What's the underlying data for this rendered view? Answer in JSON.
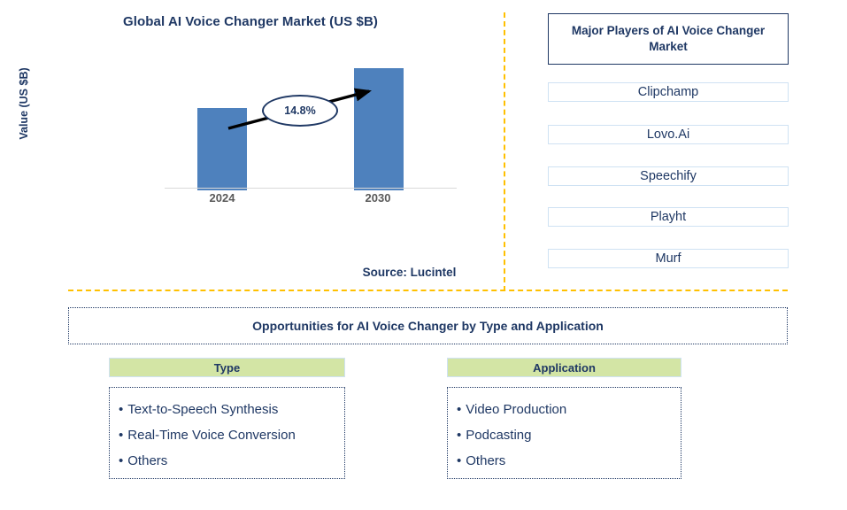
{
  "chart_panel": {
    "title": "Global AI Voice Changer Market (US $B)",
    "y_axis_label": "Value (US $B)",
    "source": "Source: Lucintel",
    "cagr_label": "14.8%"
  },
  "chart_data": {
    "type": "bar",
    "title": "Global AI Voice Changer Market (US $B)",
    "categories": [
      "2024",
      "2030"
    ],
    "values": [
      60,
      89
    ],
    "value_unit": "US $B",
    "xlabel": "",
    "ylabel": "Value (US $B)",
    "ylim": [
      0,
      100
    ],
    "grid": false,
    "legend": "none",
    "bar_color": "#4e81bd",
    "annotations": [
      {
        "text": "14.8%",
        "kind": "cagr-callout",
        "from_category": "2024",
        "to_category": "2030"
      }
    ],
    "axis_line_color": "#d9d9d9",
    "tick_label_color": "#595959"
  },
  "players_panel": {
    "header": "Major Players of AI Voice Changer Market",
    "items": [
      {
        "label": "Clipchamp"
      },
      {
        "label": "Lovo.Ai"
      },
      {
        "label": "Speechify"
      },
      {
        "label": "Playht"
      },
      {
        "label": "Murf"
      }
    ]
  },
  "opportunities": {
    "banner": "Opportunities for AI Voice Changer by Type and Application",
    "columns": [
      {
        "header": "Type",
        "bullet": "•",
        "items": [
          {
            "label": "Text-to-Speech Synthesis"
          },
          {
            "label": "Real-Time Voice Conversion"
          },
          {
            "label": "Others"
          }
        ]
      },
      {
        "header": "Application",
        "bullet": "•",
        "items": [
          {
            "label": "Video Production"
          },
          {
            "label": "Podcasting"
          },
          {
            "label": "Others"
          }
        ]
      }
    ]
  },
  "theme": {
    "navy": "#1f3864",
    "bar_blue": "#4e81bd",
    "divider_gold": "#ffc000",
    "header_green": "#d3e5a5",
    "box_border_blue": "#cfe2f3"
  }
}
